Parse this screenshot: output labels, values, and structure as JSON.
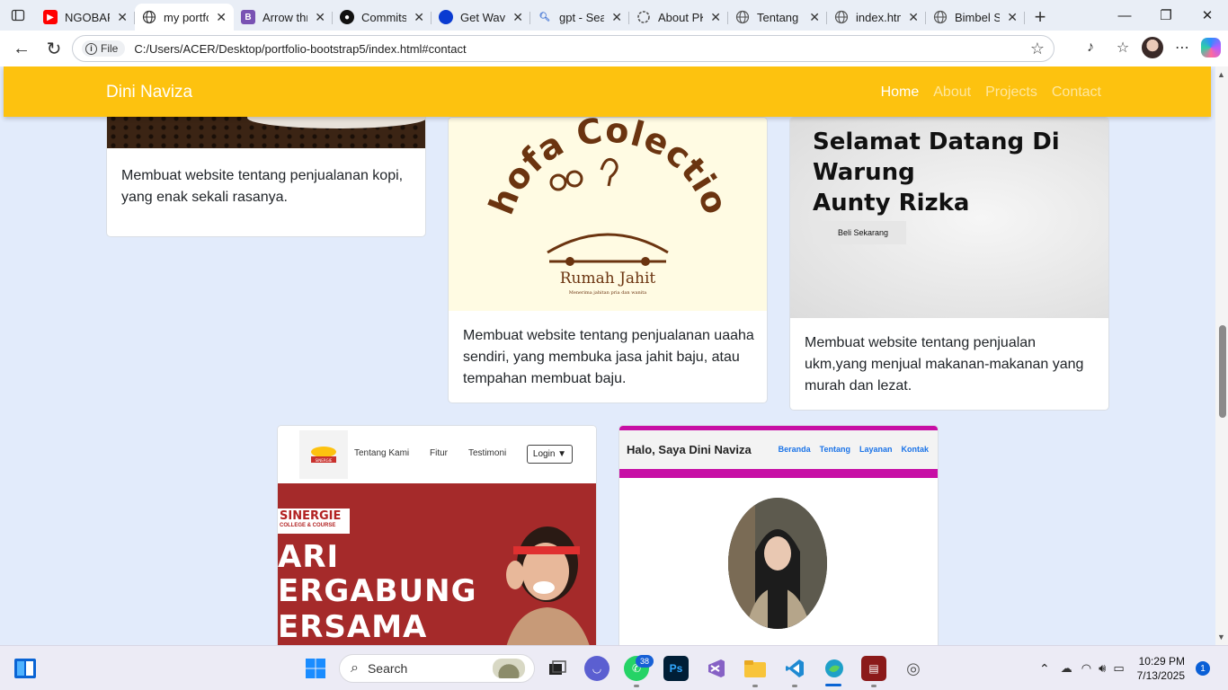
{
  "browser": {
    "tabs": [
      {
        "title": "NGOBAR",
        "favicon": "youtube-icon",
        "color": "#ff0000"
      },
      {
        "title": "my portfo",
        "favicon": "globe-icon",
        "active": true
      },
      {
        "title": "Arrow thr",
        "favicon": "bootstrap-icon",
        "color": "#7952b3"
      },
      {
        "title": "Commits",
        "favicon": "github-icon",
        "color": "#111"
      },
      {
        "title": "Get Wave",
        "favicon": "wave-icon",
        "color": "#0a3bd1"
      },
      {
        "title": "gpt - Sea",
        "favicon": "search-icon"
      },
      {
        "title": "About PK",
        "favicon": "chatgpt-icon"
      },
      {
        "title": "Tentang S",
        "favicon": "globe-icon"
      },
      {
        "title": "index.htm",
        "favicon": "globe-icon"
      },
      {
        "title": "Bimbel SI",
        "favicon": "globe-icon"
      }
    ],
    "new_tab": "+",
    "address": {
      "chip_label": "File",
      "url": "C:/Users/ACER/Desktop/portfolio-bootstrap5/index.html#contact"
    }
  },
  "site": {
    "brand": "Dini Naviza",
    "nav": [
      {
        "label": "Home",
        "current": true
      },
      {
        "label": "About",
        "current": false
      },
      {
        "label": "Projects",
        "current": false
      },
      {
        "label": "Contact",
        "current": false
      }
    ],
    "projects": [
      {
        "text": "Membuat website tentang penjualanan kopi, yang enak sekali rasanya."
      },
      {
        "text": "Membuat website tentang penjualanan uaaha sendiri, yang membuka jasa jahit baju, atau tempahan membuat baju.",
        "image": {
          "arc_text": "Shofa Colection",
          "name": "Rumah Jahit",
          "tagline": "Menerima jahitan pria dan wanita"
        }
      },
      {
        "text": "Membuat website tentang penjualan ukm,yang menjual makanan-makanan yang murah dan lezat.",
        "image": {
          "heading_line1": "Selamat Datang Di",
          "heading_line2": "Warung",
          "heading_line3": "Aunty Rizka",
          "button": "Beli Sekarang"
        }
      },
      {
        "image": {
          "nav": [
            "Tentang Kami",
            "Fitur",
            "Testimoni"
          ],
          "login": "Login ▼",
          "badge": "SINERGIE",
          "badge_sub": "COLLEGE & COURSE",
          "logo_label": "SINERGIE",
          "hero_line1": "ARI",
          "hero_line2": "ERGABUNG",
          "hero_line3": "ERSAMA"
        }
      },
      {
        "image": {
          "title": "Halo, Saya Dini Naviza",
          "nav": [
            "Beranda",
            "Tentang",
            "Layanan",
            "Kontak"
          ]
        }
      }
    ]
  },
  "taskbar": {
    "search_placeholder": "Search",
    "whatsapp_badge": "38",
    "time": "10:29 PM",
    "date": "7/13/2025",
    "notifications": "1",
    "ps_label": "Ps"
  },
  "colors": {
    "accent": "#fdc20f",
    "page_bg": "#e2ebfb",
    "magenta": "#c70fa5"
  }
}
